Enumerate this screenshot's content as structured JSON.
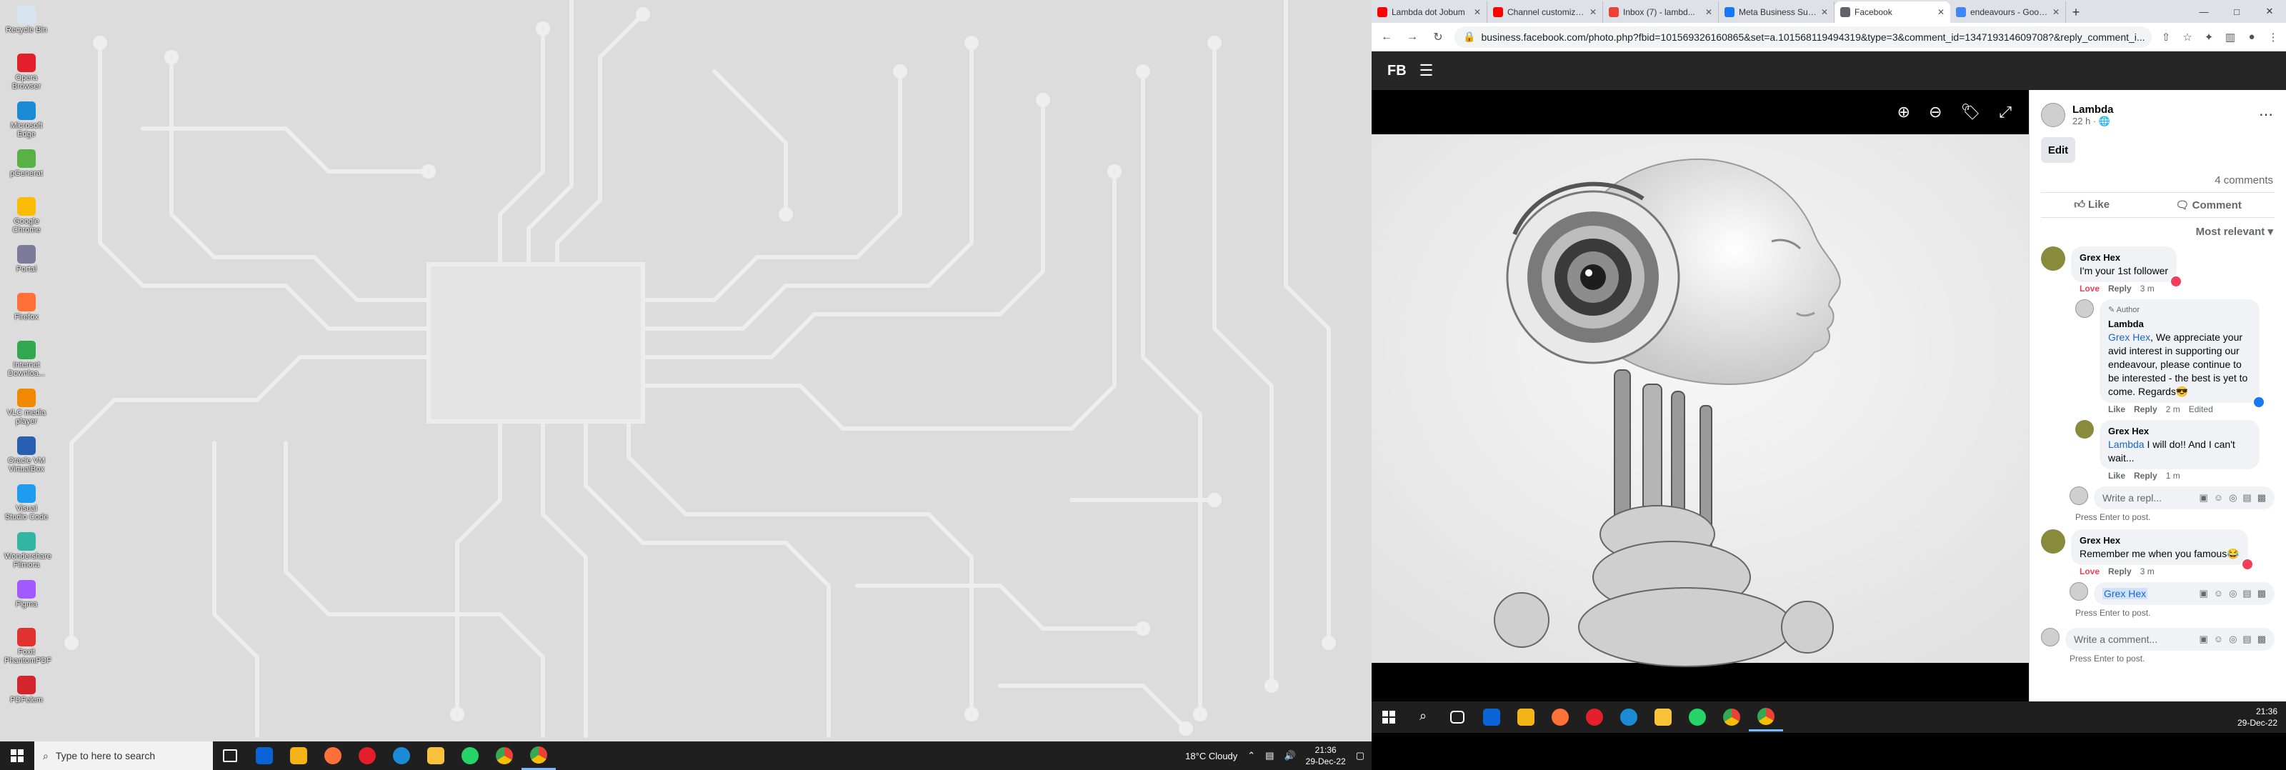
{
  "desktop": {
    "icons": [
      {
        "label": "Recycle Bin",
        "color": "#d8e4ef"
      },
      {
        "label": "Opera Browser",
        "color": "#e41e2b"
      },
      {
        "label": "Microsoft Edge",
        "color": "#1b8bd6"
      },
      {
        "label": "pGenerat",
        "color": "#58b145"
      },
      {
        "label": "Google Chrome",
        "color": "#fbbc05"
      },
      {
        "label": "Portal",
        "color": "#7c7c9a"
      },
      {
        "label": "Firefox",
        "color": "#ff7139"
      },
      {
        "label": "Internet Downloa...",
        "color": "#2fa84f"
      },
      {
        "label": "VLC media player",
        "color": "#f18900"
      },
      {
        "label": "Oracle VM VirtualBox",
        "color": "#2a5eb0"
      },
      {
        "label": "Visual Studio Code",
        "color": "#1f9cf0"
      },
      {
        "label": "Wondershare Filmora",
        "color": "#33b5a5"
      },
      {
        "label": "Figma",
        "color": "#a259ff"
      },
      {
        "label": "Foxit PhantomPDF",
        "color": "#e0332f"
      },
      {
        "label": "PDFelem",
        "color": "#d4242c"
      }
    ]
  },
  "taskbar1": {
    "search_placeholder": "Type to here to search",
    "weather": "18°C  Cloudy",
    "time": "21:36",
    "date": "29-Dec-22"
  },
  "browser": {
    "tabs": [
      {
        "title": "Lambda dot Jobum",
        "color": "#ff0000"
      },
      {
        "title": "Channel customiza...",
        "color": "#ff0000"
      },
      {
        "title": "Inbox (7) - lambd...",
        "color": "#ea4335"
      },
      {
        "title": "Meta Business Suite",
        "color": "#1877f2"
      },
      {
        "title": "Facebook",
        "color": "#5f6368",
        "active": true
      },
      {
        "title": "endeavours - Goog...",
        "color": "#4285f4"
      }
    ],
    "url": "business.facebook.com/photo.php?fbid=101569326160865&set=a.101568119494319&type=3&comment_id=134719314609708?&reply_comment_i..."
  },
  "fb": {
    "logo": "FB",
    "page_name": "Lambda",
    "post_time": "22 h",
    "edit_label": "Edit",
    "comment_count": "4 comments",
    "like_label": "Like",
    "comment_label": "Comment",
    "sort_label": "Most relevant",
    "comments": [
      {
        "name": "Grex Hex",
        "text": "I'm your 1st follower",
        "love": "Love",
        "reply": "Reply",
        "time": "3 m"
      },
      {
        "author": "Author",
        "name": "Lambda",
        "mention": "Grex Hex",
        "text": ", We appreciate your avid interest in supporting our endeavour, please continue to be interested - the best is yet to come. Regards😎",
        "like": "Like",
        "reply": "Reply",
        "time": "2 m",
        "edited": "Edited"
      },
      {
        "name": "Grex Hex",
        "mention": "Lambda",
        "text": " I will do!! And I can't wait...",
        "like": "Like",
        "reply": "Reply",
        "time": "1 m"
      },
      {
        "name": "Grex Hex",
        "text": "Remember me when you famous😂",
        "love": "Love",
        "reply": "Reply",
        "time": "3 m"
      }
    ],
    "write_reply": "Write a repl...",
    "reply_tag": "Grex Hex",
    "write_comment": "Write a comment...",
    "press_enter": "Press Enter to post."
  },
  "taskbar2": {
    "time": "21:36",
    "date": "29-Dec-22"
  }
}
